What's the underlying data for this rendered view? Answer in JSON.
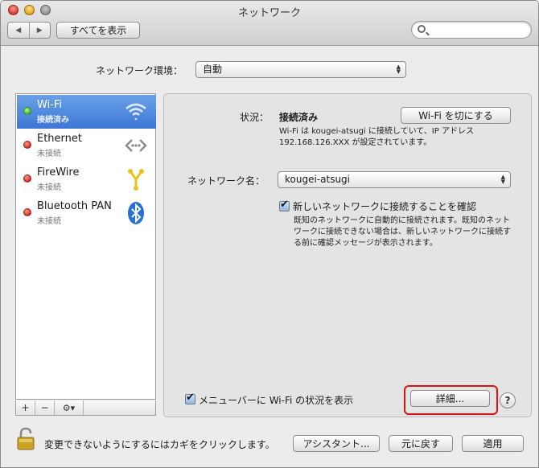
{
  "window": {
    "title": "ネットワーク",
    "show_all_label": "すべてを表示",
    "back_glyph": "◀",
    "forward_glyph": "▶",
    "search_placeholder": ""
  },
  "location": {
    "label": "ネットワーク環境：",
    "value": "自動"
  },
  "services": [
    {
      "name": "Wi-Fi",
      "status": "接続済み",
      "state": "connected",
      "icon": "wifi-icon",
      "selected": true
    },
    {
      "name": "Ethernet",
      "status": "未接続",
      "state": "disconnected",
      "icon": "ethernet-icon",
      "selected": false
    },
    {
      "name": "FireWire",
      "status": "未接続",
      "state": "disconnected",
      "icon": "firewire-icon",
      "selected": false
    },
    {
      "name": "Bluetooth PAN",
      "status": "未接続",
      "state": "disconnected",
      "icon": "bluetooth-icon",
      "selected": false
    }
  ],
  "sidebar_bar": {
    "add": "+",
    "remove": "−",
    "gear": "⚙▾"
  },
  "detail": {
    "status_label": "状況：",
    "status_value": "接続済み",
    "wifi_off_button": "Wi-Fi を切にする",
    "status_desc": "Wi-Fi は kougei-atsugi に接続していて、IP アドレス 192.168.126.XXX が設定されています。",
    "network_name_label": "ネットワーク名：",
    "network_name_value": "kougei-atsugi",
    "join_checkbox_label": "新しいネットワークに接続することを確認",
    "join_checkbox_checked": true,
    "join_desc": "既知のネットワークに自動的に接続されます。既知のネットワークに接続できない場合は、新しいネットワークに接続する前に確認メッセージが表示されます。",
    "menubar_checkbox_label": "メニューバーに Wi-Fi の状況を表示",
    "menubar_checkbox_checked": true,
    "advanced_button": "詳細...",
    "help_label": "?"
  },
  "footer": {
    "lock_text": "変更できないようにするにはカギをクリックします。",
    "assistant_button": "アシスタント...",
    "revert_button": "元に戻す",
    "apply_button": "適用"
  },
  "colors": {
    "selection": "#3d77d6",
    "connected_dot": "#3fb92a",
    "disconnected_dot": "#d6291e",
    "highlight_box": "#e01010"
  }
}
